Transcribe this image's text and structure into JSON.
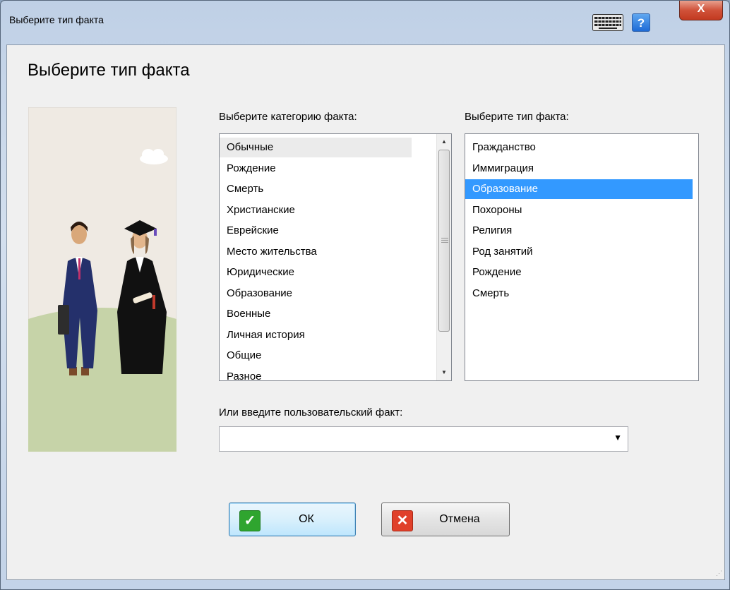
{
  "window": {
    "title": "Выберите тип факта",
    "close_label": "X",
    "help_label": "?"
  },
  "dialog": {
    "heading": "Выберите тип факта",
    "category_label": "Выберите категорию факта:",
    "type_label": "Выберите тип факта:",
    "custom_label": "Или введите пользовательский факт:",
    "custom_value": ""
  },
  "categories": {
    "selected_index": 0,
    "items": [
      "Обычные",
      "Рождение",
      "Смерть",
      "Христианские",
      "Еврейские",
      "Место жительства",
      "Юридические",
      "Образование",
      "Военные",
      "Личная история",
      "Общие",
      "Разное"
    ]
  },
  "types": {
    "selected_index": 2,
    "items": [
      "Гражданство",
      "Иммиграция",
      "Образование",
      "Похороны",
      "Религия",
      "Род занятий",
      "Рождение",
      "Смерть"
    ]
  },
  "buttons": {
    "ok_label": "ОК",
    "cancel_label": "Отмена"
  },
  "colors": {
    "selection": "#3399ff",
    "ok_icon": "#2fa52f",
    "cancel_icon": "#e0402a"
  }
}
